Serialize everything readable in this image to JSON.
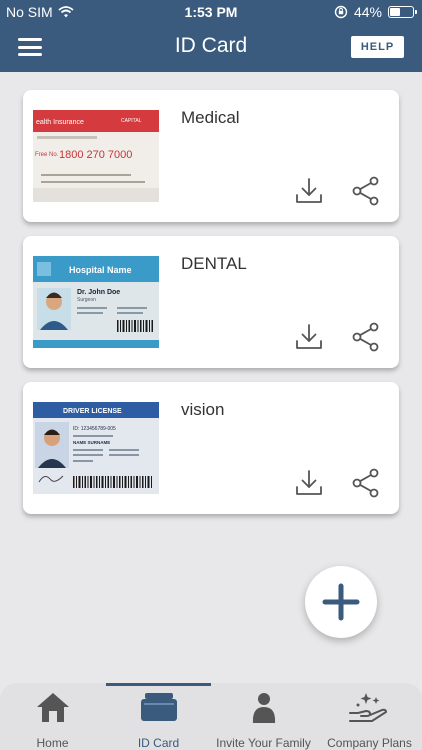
{
  "status_bar": {
    "carrier": "No SIM",
    "time": "1:53 PM",
    "battery": "44%",
    "battery_level": 0.44
  },
  "header": {
    "title": "ID Card",
    "help_label": "HELP"
  },
  "cards": [
    {
      "name": "Medical",
      "thumb": {
        "header": "ealth Insurance",
        "logo": "CAPITAL",
        "phone_label": "Free No.",
        "phone": "1800 270 7000"
      }
    },
    {
      "name": "DENTAL",
      "thumb": {
        "header": "Hospital Name",
        "person": "Dr. John Doe",
        "role": "Surgeon"
      }
    },
    {
      "name": "vision",
      "thumb": {
        "header": "DRIVER LICENSE",
        "id": "ID: 123456789-005",
        "name_label": "NAME SURNAME"
      }
    }
  ],
  "tabs": [
    {
      "label": "Home",
      "icon": "home-icon"
    },
    {
      "label": "ID Card",
      "icon": "id-card-icon"
    },
    {
      "label": "Invite Your Family",
      "icon": "person-icon"
    },
    {
      "label": "Company Plans",
      "icon": "hand-sparkle-icon"
    }
  ],
  "active_tab": "ID Card",
  "colors": {
    "brand": "#3a5a7e",
    "background": "#e8e8ea",
    "icon_gray": "#555555"
  }
}
